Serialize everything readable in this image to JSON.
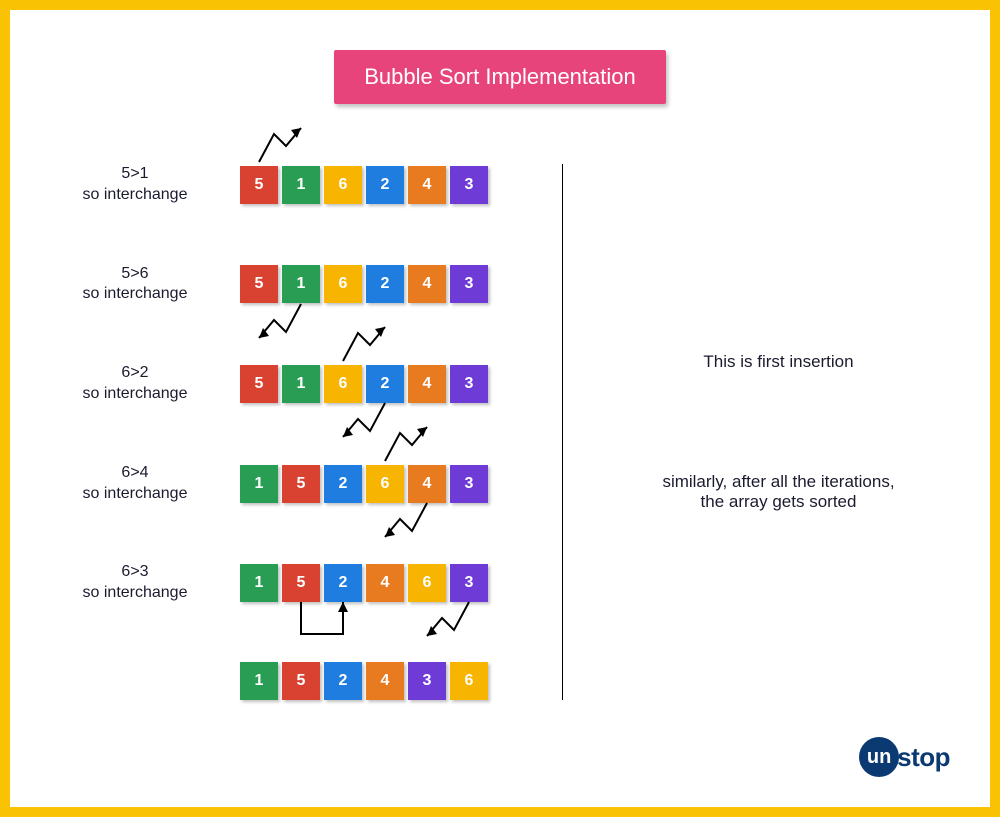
{
  "title": "Bubble Sort Implementation",
  "colors": {
    "red": "#d94131",
    "green": "#2a9d54",
    "yellow": "#f7b400",
    "blue": "#1f7de0",
    "orange": "#e87a1f",
    "purple": "#6f3bd6"
  },
  "steps": [
    {
      "comparison": "5>1",
      "action": "so interchange",
      "cells": [
        {
          "value": "5",
          "color": "red"
        },
        {
          "value": "1",
          "color": "green"
        },
        {
          "value": "6",
          "color": "yellow"
        },
        {
          "value": "2",
          "color": "blue"
        },
        {
          "value": "4",
          "color": "orange"
        },
        {
          "value": "3",
          "color": "purple"
        }
      ],
      "swap_from": 0,
      "swap_to": 1,
      "arrow": "above"
    },
    {
      "comparison": "5>6",
      "action": "so interchange",
      "cells": [
        {
          "value": "5",
          "color": "red"
        },
        {
          "value": "1",
          "color": "green"
        },
        {
          "value": "6",
          "color": "yellow"
        },
        {
          "value": "2",
          "color": "blue"
        },
        {
          "value": "4",
          "color": "orange"
        },
        {
          "value": "3",
          "color": "purple"
        }
      ],
      "swap_from": 0,
      "swap_to": 1,
      "arrow": "below"
    },
    {
      "comparison": "6>2",
      "action": "so interchange",
      "cells": [
        {
          "value": "5",
          "color": "red"
        },
        {
          "value": "1",
          "color": "green"
        },
        {
          "value": "6",
          "color": "yellow"
        },
        {
          "value": "2",
          "color": "blue"
        },
        {
          "value": "4",
          "color": "orange"
        },
        {
          "value": "3",
          "color": "purple"
        }
      ],
      "swap_from": 2,
      "swap_to": 3,
      "arrow": "both"
    },
    {
      "comparison": "6>4",
      "action": "so interchange",
      "cells": [
        {
          "value": "1",
          "color": "green"
        },
        {
          "value": "5",
          "color": "red"
        },
        {
          "value": "2",
          "color": "blue"
        },
        {
          "value": "6",
          "color": "yellow"
        },
        {
          "value": "4",
          "color": "orange"
        },
        {
          "value": "3",
          "color": "purple"
        }
      ],
      "swap_from": 3,
      "swap_to": 4,
      "arrow": "both"
    },
    {
      "comparison": "6>3",
      "action": "so interchange",
      "cells": [
        {
          "value": "1",
          "color": "green"
        },
        {
          "value": "5",
          "color": "red"
        },
        {
          "value": "2",
          "color": "blue"
        },
        {
          "value": "4",
          "color": "orange"
        },
        {
          "value": "6",
          "color": "yellow"
        },
        {
          "value": "3",
          "color": "purple"
        }
      ],
      "swap_from": 4,
      "swap_to": 5,
      "arrow": "below",
      "extra_bracket": {
        "from": 1,
        "to": 2
      }
    },
    {
      "comparison": "",
      "action": "",
      "cells": [
        {
          "value": "1",
          "color": "green"
        },
        {
          "value": "5",
          "color": "red"
        },
        {
          "value": "2",
          "color": "blue"
        },
        {
          "value": "4",
          "color": "orange"
        },
        {
          "value": "3",
          "color": "purple"
        },
        {
          "value": "6",
          "color": "yellow"
        }
      ]
    }
  ],
  "right_notes": {
    "first": "This is first insertion",
    "second": "similarly, after all the iterations,\nthe array gets sorted"
  },
  "logo": {
    "circle_text": "un",
    "rest": "stop"
  }
}
